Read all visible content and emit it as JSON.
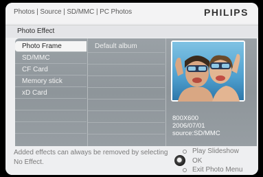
{
  "header": {
    "breadcrumb": "Photos | Source | SD/MMC | PC Photos",
    "brand": "PHILIPS"
  },
  "page": {
    "title": "Photo Effect"
  },
  "menu": {
    "items": [
      {
        "label": "Photo Frame",
        "selected": true
      },
      {
        "label": "SD/MMC",
        "selected": false
      },
      {
        "label": "CF Card",
        "selected": false
      },
      {
        "label": "Memory stick",
        "selected": false
      },
      {
        "label": "xD Card",
        "selected": false
      }
    ]
  },
  "albums": {
    "items": [
      "Default album"
    ]
  },
  "preview": {
    "resolution": "800X600",
    "date": "2006/07/01",
    "source": "source:SD/MMC"
  },
  "footer": {
    "hint_line1": "Added effects can always be removed by selecting",
    "hint_line2": "No Effect.",
    "nav": {
      "up_label": "Play Slideshow",
      "ok_label": "OK",
      "down_label": "Exit Photo Menu"
    }
  },
  "colors": {
    "panel": "#959ca1",
    "selected_bg": "#f5f5f5",
    "frame_bg": "#eeeff1"
  }
}
